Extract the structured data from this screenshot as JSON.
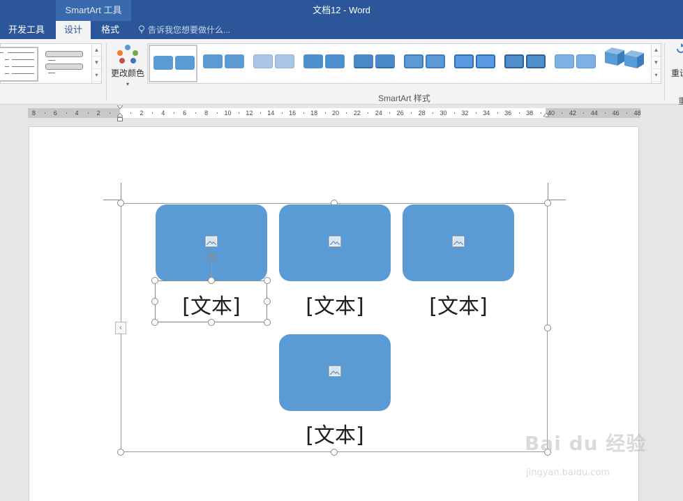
{
  "window": {
    "context_tools": "SmartArt 工具",
    "doc_title": "文档12 - Word"
  },
  "tabs": [
    {
      "label": "开发工具"
    },
    {
      "label": "设计"
    },
    {
      "label": "格式"
    }
  ],
  "tell_me": {
    "placeholder": "告诉我您想要做什么..."
  },
  "ribbon": {
    "change_colors_label": "更改颜色",
    "styles_group_label": "SmartArt 样式",
    "reset_label": "重设",
    "reset_group_label": "重"
  },
  "ruler": {
    "left_numbers": [
      "8",
      "6",
      "4",
      "2"
    ],
    "right_numbers": [
      "2",
      "4",
      "6",
      "8",
      "10",
      "12",
      "14",
      "16",
      "18",
      "20",
      "22",
      "24",
      "26",
      "28",
      "30",
      "32",
      "34",
      "36",
      "38",
      "40",
      "42",
      "44",
      "46",
      "48"
    ]
  },
  "smartart": {
    "captions": [
      "[文本]",
      "[文本]",
      "[文本]",
      "[文本]"
    ]
  },
  "colors": {
    "title_bar": "#2b579a",
    "shape_fill": "#5b9bd5"
  },
  "watermark": {
    "brand": "Bai du 经验",
    "url": "jingyan.baidu.com"
  }
}
